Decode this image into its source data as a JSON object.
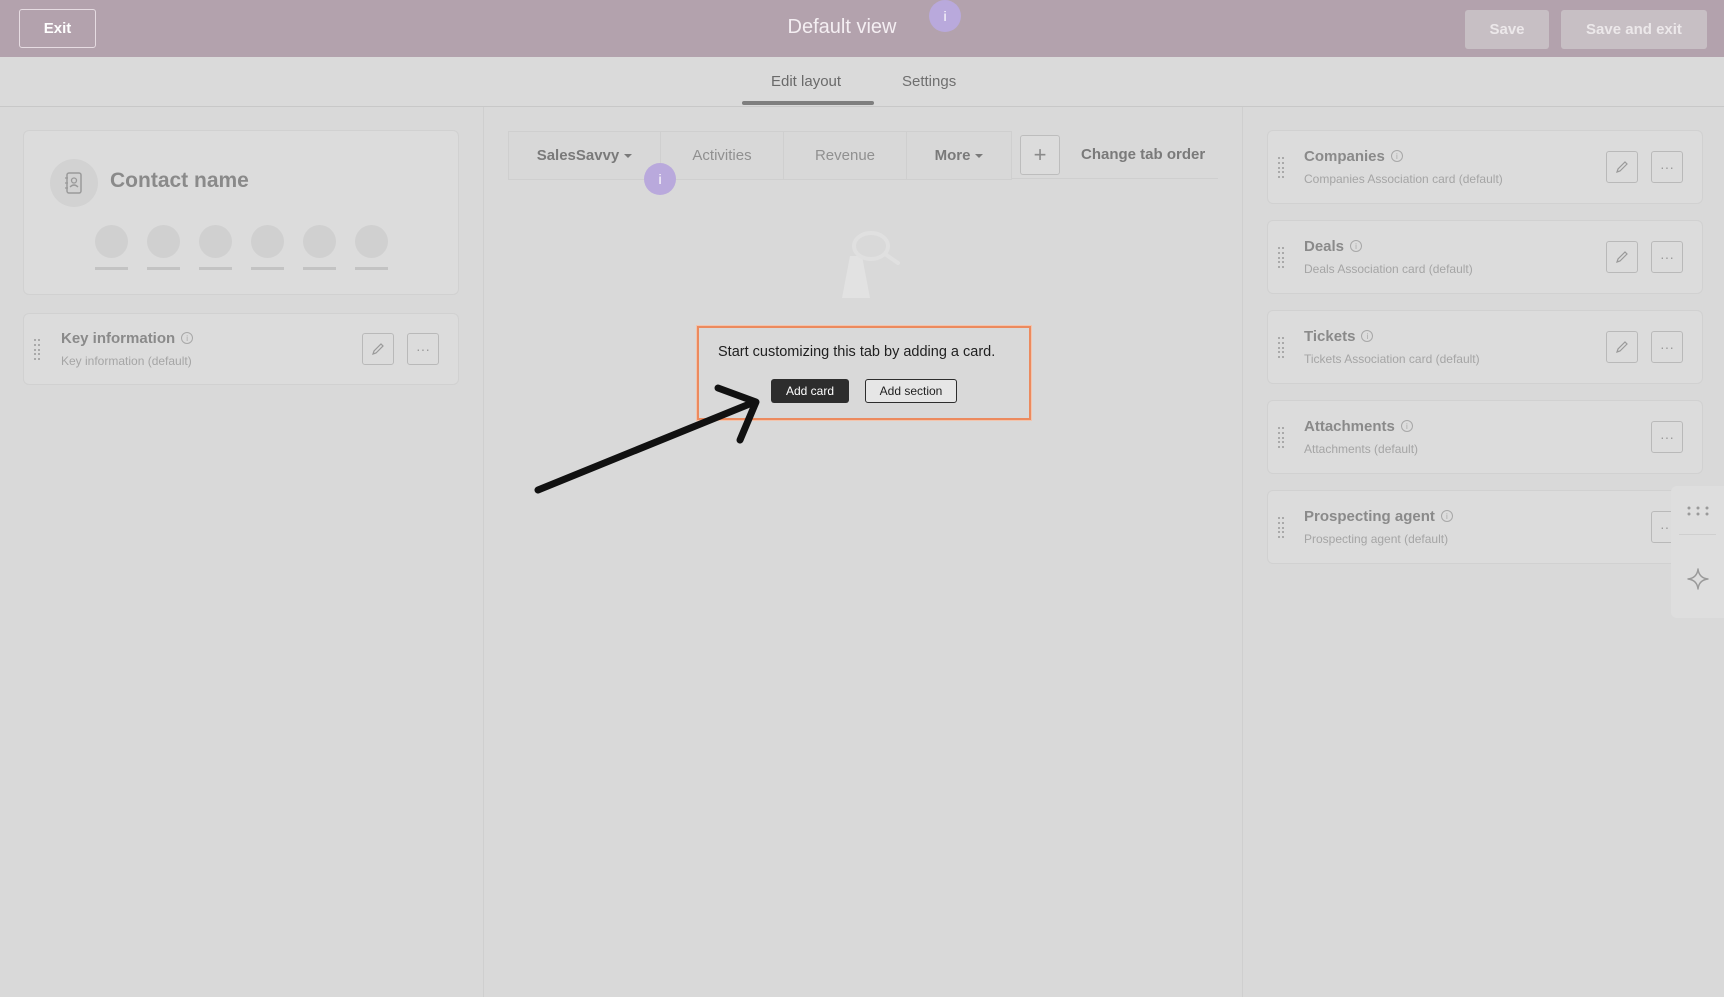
{
  "header": {
    "exit_label": "Exit",
    "title": "Default view",
    "info_badge": "i",
    "save_label": "Save",
    "save_exit_label": "Save and exit"
  },
  "page_tabs": {
    "edit_layout": "Edit layout",
    "settings": "Settings"
  },
  "left_column": {
    "contact_card": {
      "title": "Contact name"
    },
    "key_info": {
      "title": "Key information",
      "subtitle": "Key information (default)",
      "more": "···"
    }
  },
  "middle_column": {
    "tabs": [
      {
        "label": "SalesSavvy"
      },
      {
        "label": "Activities"
      },
      {
        "label": "Revenue"
      },
      {
        "label": "More"
      }
    ],
    "add_tab": "+",
    "change_order": "Change tab order",
    "info_badge": "i",
    "popup": {
      "text": "Start customizing this tab by adding a card.",
      "add_card": "Add card",
      "add_section": "Add section"
    }
  },
  "right_column": {
    "cards": [
      {
        "title": "Companies",
        "subtitle": "Companies Association card (default)",
        "editable": true
      },
      {
        "title": "Deals",
        "subtitle": "Deals Association card (default)",
        "editable": true
      },
      {
        "title": "Tickets",
        "subtitle": "Tickets Association card (default)",
        "editable": true
      },
      {
        "title": "Attachments",
        "subtitle": "Attachments (default)",
        "editable": false
      },
      {
        "title": "Prospecting agent",
        "subtitle": "Prospecting agent (default)",
        "editable": false
      }
    ],
    "more": "···"
  },
  "colors": {
    "header_bg": "#b3a2ad",
    "page_bg": "#d9d9d9",
    "popup_border": "#ec8a5e",
    "info_badge": "#b9a9dc",
    "primary_button": "#2d2d2d"
  }
}
